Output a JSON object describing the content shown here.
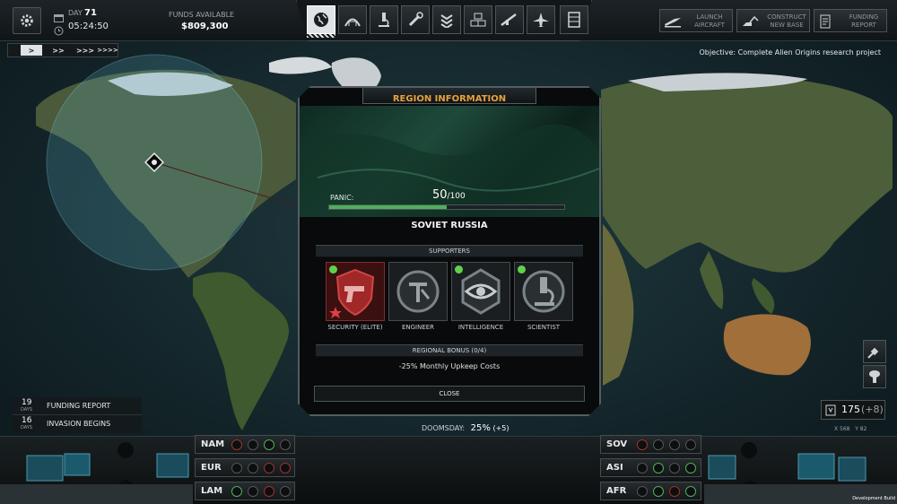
{
  "hud": {
    "day_label": "DAY",
    "day_value": "71",
    "time": "05:24:50",
    "funds_label": "FUNDS AVAILABLE",
    "funds_value": "$809,300",
    "objective": "Objective: Complete Alien Origins research project",
    "launch_aircraft": [
      "LAUNCH",
      "AIRCRAFT"
    ],
    "construct_base": [
      "CONSTRUCT",
      "NEW BASE"
    ],
    "funding_report_btn": [
      "FUNDING",
      "REPORT"
    ],
    "nav_icons": [
      "globe-icon",
      "hangar-icon",
      "research-icon",
      "engineering-icon",
      "rank-icon",
      "facilities-icon",
      "weapon-icon",
      "jet-icon",
      "archives-icon"
    ]
  },
  "time_controls": [
    ">",
    ">>",
    ">>>",
    ">>>>"
  ],
  "events": [
    {
      "days": "19",
      "unit": "DAYS",
      "label": "FUNDING REPORT"
    },
    {
      "days": "16",
      "unit": "DAYS",
      "label": "INVASION BEGINS"
    }
  ],
  "modal": {
    "title": "REGION INFORMATION",
    "panic_label": "PANIC:",
    "panic_value": "50",
    "panic_max": "/100",
    "panic_fraction": 0.5,
    "region_name": "SOVIET RUSSIA",
    "supporters_label": "SUPPORTERS",
    "supporters": [
      {
        "label": "SECURITY (ELITE)",
        "icon": "pistol-shield-icon",
        "active": true
      },
      {
        "label": "ENGINEER",
        "icon": "caliper-icon",
        "active": false
      },
      {
        "label": "INTELLIGENCE",
        "icon": "eye-icon",
        "active": true
      },
      {
        "label": "SCIENTIST",
        "icon": "microscope-icon",
        "active": true
      }
    ],
    "bonus_label": "REGIONAL BONUS",
    "bonus_count": "(0/4)",
    "bonus_text": "-25% Monthly Upkeep Costs",
    "close_label": "CLOSE"
  },
  "doomsday": {
    "label": "DOOMSDAY:",
    "value": "25%",
    "delta": "(+5)"
  },
  "regions_left": [
    "NAM",
    "EUR",
    "LAM"
  ],
  "regions_right": [
    "SOV",
    "ASI",
    "AFR"
  ],
  "resources": {
    "value": "175",
    "delta": "(+8)",
    "coords": "X 568   Y 82"
  },
  "footer": "Development Build",
  "colors": {
    "accent": "#e9a13b",
    "panic_green": "#4fb05a",
    "active_dot": "#5fd24a",
    "security_red": "#c23a3a"
  }
}
